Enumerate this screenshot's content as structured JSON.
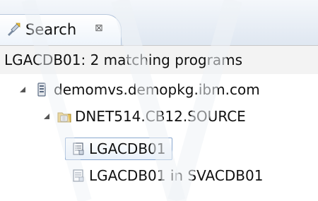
{
  "tab": {
    "label": "Search",
    "close_glyph": "⊠",
    "icon": "search-flashlight-icon"
  },
  "header": {
    "text": "LGACDB01: 2 matching programs"
  },
  "tree": {
    "system": {
      "label": "demomvs.demopkg.ibm.com",
      "icon": "mvs-system-icon"
    },
    "dataset": {
      "label": "DNET514.CB12.SOURCE",
      "icon": "pds-folder-icon"
    },
    "members": [
      {
        "label": "LGACDB01",
        "icon": "program-member-icon",
        "selected": true
      },
      {
        "label": "LGACDB01 in SVACDB01",
        "icon": "program-member-icon",
        "selected": false
      }
    ]
  },
  "colors": {
    "selection_border": "#8aa8cf",
    "header_bg": "#f3f3f3",
    "tab_gradient_top": "#ffffff",
    "tab_gradient_bottom": "#eef4fb"
  }
}
